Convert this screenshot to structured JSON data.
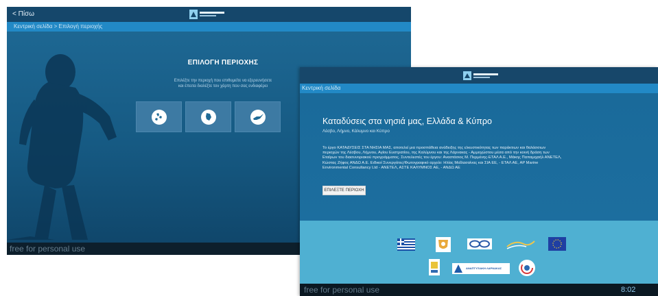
{
  "screen1": {
    "back_label": "< Πίσω",
    "breadcrumb": "Κεντρική σελίδα > Επιλογή περιοχής",
    "title": "ΕΠΙΛΟΓΗ ΠΕΡΙΟΧΗΣ",
    "description_line1": "Επιλέξτε την περιοχή που επιθυμείτε να εξερευνήσετε",
    "description_line2": "και έπειτα διαλέξτε τον χάρτη που σας ενδιαφέρει",
    "region_buttons": [
      {
        "icon": "greece-islands-map-icon"
      },
      {
        "icon": "kalymnos-map-icon"
      },
      {
        "icon": "cyprus-map-icon"
      }
    ],
    "watermark": "free for personal use"
  },
  "screen2": {
    "breadcrumb": "Κεντρική σελίδα",
    "heading": "Καταδύσεις στα νησιά μας, Ελλάδα & Κύπρο",
    "subheading": "Λέσβο, Λήμνο, Κάλυμνο και Κύπρο",
    "body": "Το έργο ΚΑΤΑΔΥΣΕΙΣ ΣΤΑ ΝΗΣΙΑ ΜΑΣ, αποτελεί μια προσπάθεια ανάδειξης της ελκυστικότητας των παράκτιων και θαλάσσιων περιοχών της Λέσβου, Λήμνου, Αγίου Ευστρατίου, της Καλύμνου και της Λάρνακας - Αμμοχώστου μέσα από την κοινή δράση των Εταίρων του διασυνοριακού προγράμματος. Συντελεστές του έργου: Αναστάσιος Μ. Περμένης-ΕΤΑΛ Α.Ε., Μάκης Παπαμιχαήλ ΑΝΕΤΕΛ, Κώστας Ζήφος ΑΝΔΩ Α.Ε. Ειδικοί Συνεργάτες/Φωτογραφικό αρχείο: Ηλίας Μαΐλασαίνας και ΣΙΑ ΕΕ, - ΕΤΑΛ ΑΕ, AP Marine Environmental Consultancy Ltd - ΑΝΕΤΕΛ, ΑΣΤΕ ΚΑΛΥΜΝΟΣ ΑΕ, - ΑΝΔΩ ΑΕ",
    "choose_button": "ΕΠΙΛΕΞΤΕ ΠΕΡΙΟΧΗ",
    "footer_logos": [
      "greek-flag-icon",
      "cyprus-emblem-icon",
      "partner-logo-icon",
      "programme-logo-icon",
      "eu-flag-icon",
      "dive-logo-icon",
      "larnaca-development-logo-icon",
      "circle-logo-icon"
    ],
    "logo_caption": "ΑΝΑΠΤΥΞΙΑΚΗ ΛΑΡΝΑΚΑΣ",
    "watermark": "free for personal use",
    "clock": "8:02"
  },
  "colors": {
    "bar_dark": "#15476b",
    "breadcrumb_blue": "#2289c6",
    "footer_cyan": "#4fb0d2"
  }
}
